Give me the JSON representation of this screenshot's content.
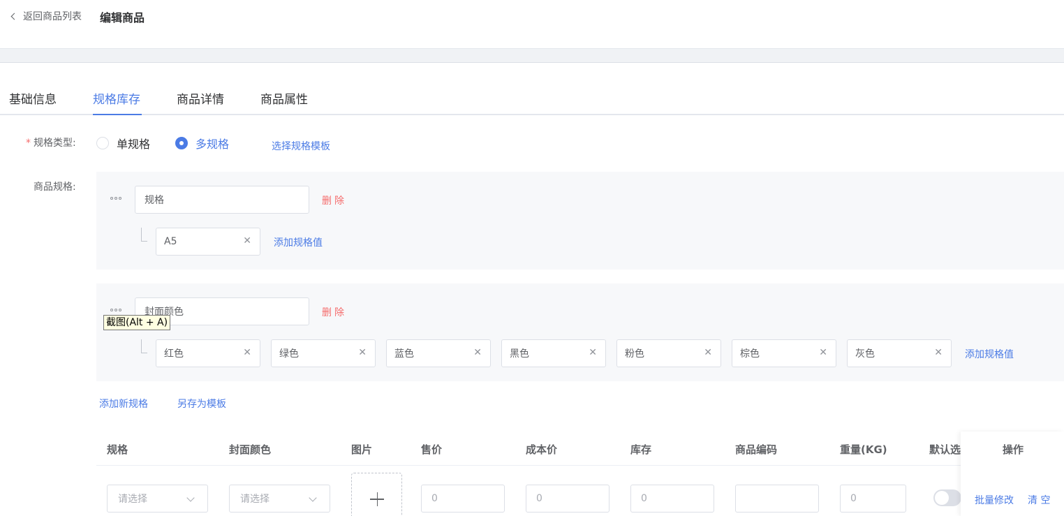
{
  "header": {
    "back_label": "返回商品列表",
    "title": "编辑商品"
  },
  "tabs": [
    {
      "label": "基础信息"
    },
    {
      "label": "规格库存"
    },
    {
      "label": "商品详情"
    },
    {
      "label": "商品属性"
    }
  ],
  "active_tab": "规格库存",
  "spec_type": {
    "required_mark": "*",
    "label": "规格类型:",
    "options": [
      "单规格",
      "多规格"
    ],
    "selected": "多规格",
    "template_link": "选择规格模板"
  },
  "specs": {
    "label": "商品规格:",
    "delete_label": "删除",
    "add_value_label": "添加规格值",
    "groups": [
      {
        "name": "规格",
        "values": [
          "A5"
        ]
      },
      {
        "name": "封面颜色",
        "values": [
          "红色",
          "绿色",
          "蓝色",
          "黑色",
          "粉色",
          "棕色",
          "灰色"
        ]
      }
    ],
    "add_spec_label": "添加新规格",
    "save_template_label": "另存为模板"
  },
  "tooltip": "截图(Alt + A)",
  "table": {
    "columns": [
      "规格",
      "封面颜色",
      "图片",
      "售价",
      "成本价",
      "库存",
      "商品编码",
      "重量(KG)",
      "默认选",
      "操作"
    ],
    "row": {
      "spec_placeholder": "请选择",
      "color_placeholder": "请选择",
      "price": "0",
      "cost": "0",
      "stock": "0",
      "code": "",
      "weight": "0",
      "default_on": false
    },
    "batch_edit_label": "批量修改",
    "clear_label": "清 空"
  },
  "colors": {
    "accent": "#4b7be5",
    "danger": "#f56c6c"
  }
}
